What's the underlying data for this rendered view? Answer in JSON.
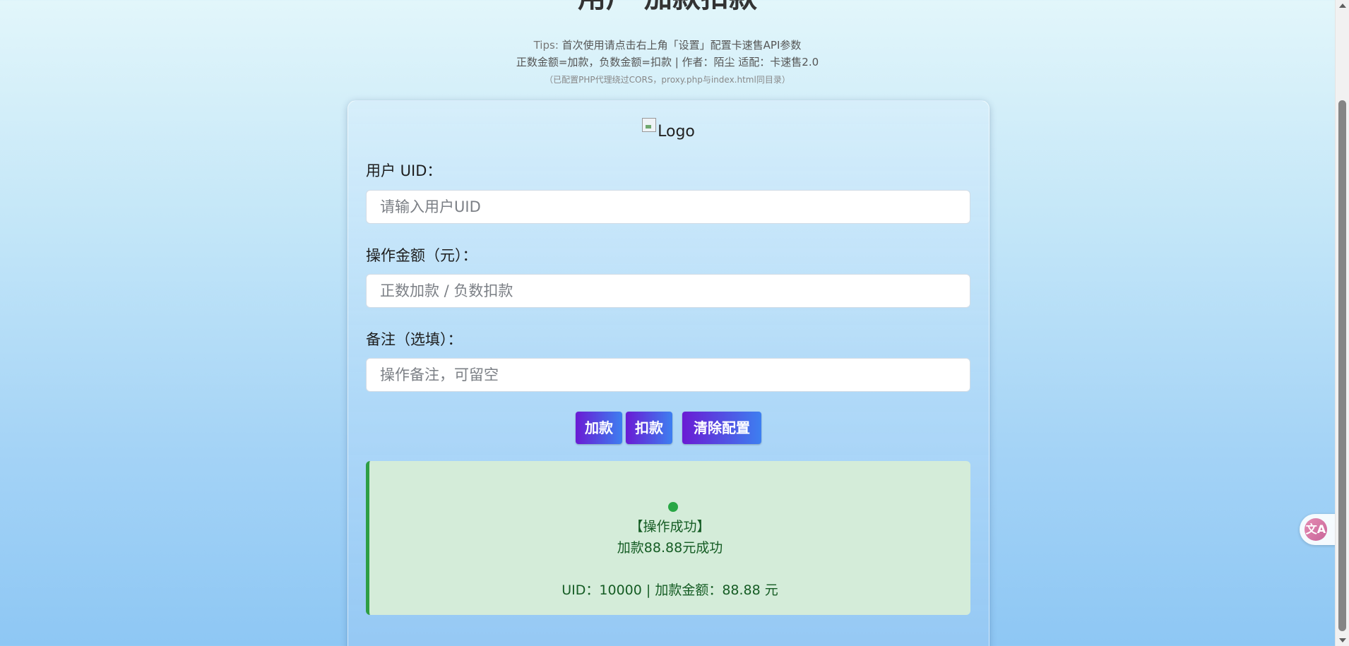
{
  "header": {
    "title": "用户 加款扣款",
    "tips_label": "Tips:",
    "tips_text": "首次使用请点击右上角「设置」配置卡速售API参数",
    "info_line": "正数金额=加款，负数金额=扣款 | 作者：陌尘 适配：卡速售2.0",
    "note_line": "（已配置PHP代理绕过CORS，proxy.php与index.html同目录）"
  },
  "form": {
    "logo_alt": "Logo",
    "uid_label": "用户 UID：",
    "uid_placeholder": "请输入用户UID",
    "amount_label": "操作金额（元）：",
    "amount_placeholder": "正数加款 / 负数扣款",
    "remark_label": "备注（选填）：",
    "remark_placeholder": "操作备注，可留空"
  },
  "buttons": {
    "add_label": "加款",
    "deduct_label": "扣款",
    "clear_label": "清除配置"
  },
  "result": {
    "status": "success",
    "title": "【操作成功】",
    "message": "加款88.88元成功",
    "detail": "UID：10000 | 加款金额：88.88 元"
  },
  "floating": {
    "translate_icon": "文A"
  },
  "colors": {
    "button_gradient_start": "#6a1bd4",
    "button_gradient_end": "#3d7ff0",
    "success_bg": "#d4ecd9",
    "success_border": "#2e9e44",
    "success_text": "#155c24"
  },
  "icons": {
    "logo": "broken-image-icon",
    "result": "success-dot-icon",
    "translate": "translate-icon"
  }
}
